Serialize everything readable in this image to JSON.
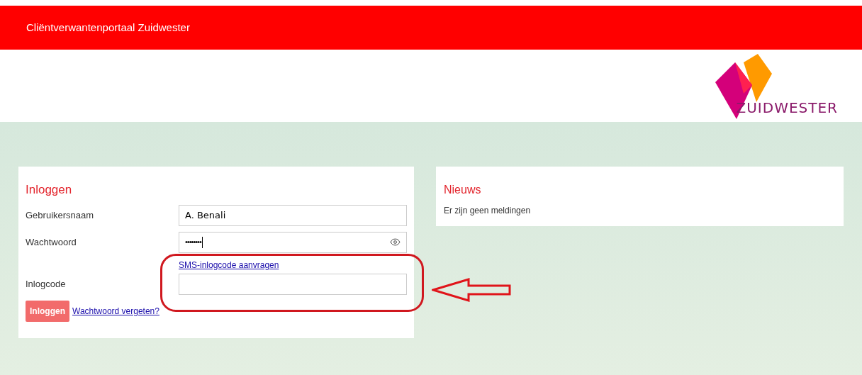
{
  "header": {
    "title": "Cliëntverwantenportaal Zuidwester"
  },
  "logo": {
    "text": "ZUIDWESTER"
  },
  "login": {
    "title": "Inloggen",
    "fields": [
      {
        "label": "Gebruikersnaam",
        "kind": "text",
        "value": "A. Benali"
      },
      {
        "label": "Wachtwoord",
        "kind": "password",
        "value": "••••••••"
      },
      {
        "label": "Inlogcode",
        "kind": "code",
        "link": "SMS-inlogcode aanvragen"
      }
    ],
    "button": "Inloggen",
    "forgot_link": "Wachtwoord vergeten?"
  },
  "news": {
    "title": "Nieuws",
    "message": "Er zijn geen meldingen"
  }
}
